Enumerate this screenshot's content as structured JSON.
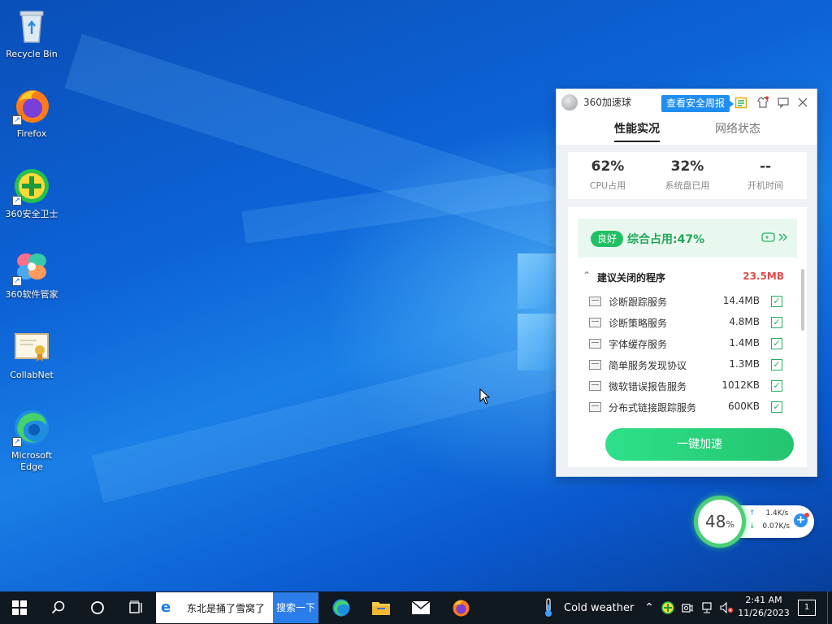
{
  "desktop": {
    "icons": [
      {
        "label": "Recycle Bin"
      },
      {
        "label": "Firefox"
      },
      {
        "label": "360安全卫士"
      },
      {
        "label": "360软件管家"
      },
      {
        "label": "CollabNet"
      },
      {
        "label": "Microsoft Edge"
      }
    ]
  },
  "panel": {
    "app_name": "360加速球",
    "report_button": "查看安全周报",
    "tabs": [
      {
        "label": "性能实况",
        "active": true
      },
      {
        "label": "网络状态",
        "active": false
      }
    ],
    "stats": [
      {
        "value": "62%",
        "label": "CPU占用"
      },
      {
        "value": "32%",
        "label": "系统盘已用"
      },
      {
        "value": "--",
        "label": "开机时间"
      }
    ],
    "status_badge": "良好",
    "overall_label": "综合占用:47%",
    "section_title": "建议关闭的程序",
    "section_total": "23.5MB",
    "processes": [
      {
        "name": "诊断跟踪服务",
        "size": "14.4MB",
        "checked": true
      },
      {
        "name": "诊断策略服务",
        "size": "4.8MB",
        "checked": true
      },
      {
        "name": "字体缓存服务",
        "size": "1.4MB",
        "checked": true
      },
      {
        "name": "简单服务发现协议",
        "size": "1.3MB",
        "checked": true
      },
      {
        "name": "微软错误报告服务",
        "size": "1012KB",
        "checked": true
      },
      {
        "name": "分布式链接跟踪服务",
        "size": "600KB",
        "checked": true
      }
    ],
    "boost_button": "一键加速",
    "colors": {
      "accent": "#22c065",
      "report_blue": "#1f8ef1",
      "warn_red": "#e14b4b"
    }
  },
  "widget": {
    "percent": "48",
    "percent_unit": "%",
    "upload": "1.4K/s",
    "download": "0.07K/s"
  },
  "taskbar": {
    "search_text": "东北是捅了雪窝了",
    "search_button": "搜索一下",
    "weather": "Cold weather",
    "time": "2:41 AM",
    "date": "11/26/2023",
    "notification_count": "1"
  }
}
